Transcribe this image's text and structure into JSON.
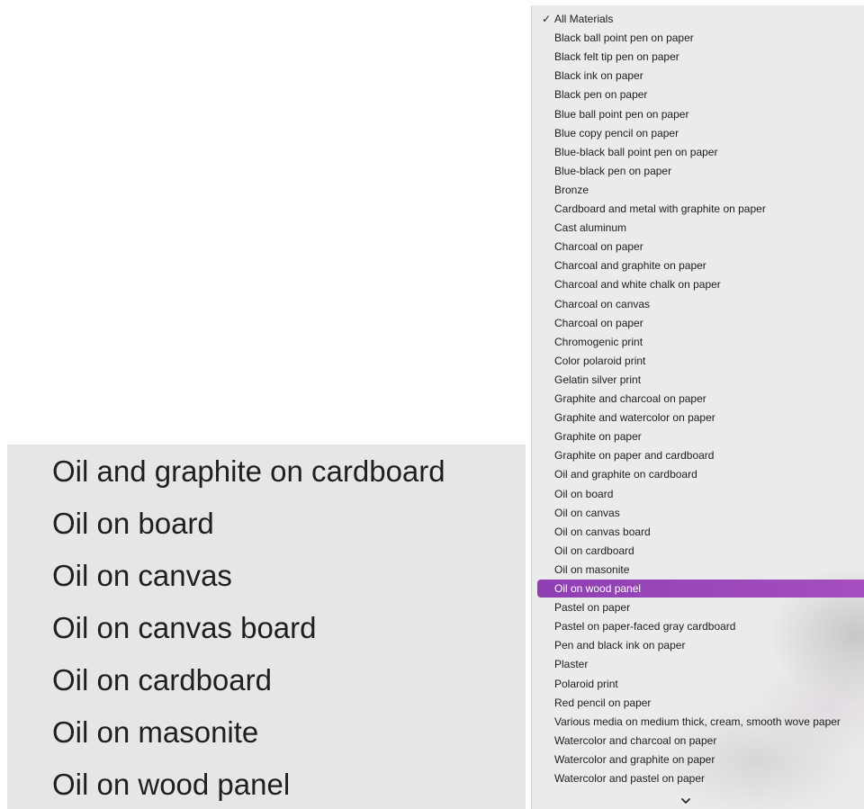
{
  "zoom": {
    "items": [
      "Oil and graphite on cardboard",
      "Oil on board",
      "Oil on canvas",
      "Oil on canvas board",
      "Oil on cardboard",
      "Oil on masonite",
      "Oil on wood panel"
    ]
  },
  "menu": {
    "check_mark": "✓",
    "selected_index": 0,
    "highlighted_index": 30,
    "highlight_color": "#9b47bb",
    "items": [
      "All Materials",
      "Black ball point pen on paper",
      "Black felt tip pen on paper",
      "Black ink on paper",
      "Black pen on paper",
      "Blue ball point pen on paper",
      "Blue copy pencil on paper",
      "Blue-black ball point pen on paper",
      "Blue-black pen on paper",
      "Bronze",
      "Cardboard and metal with graphite on paper",
      "Cast aluminum",
      "Charcoal on paper",
      "Charcoal and graphite on paper",
      "Charcoal and white chalk on paper",
      "Charcoal on canvas",
      "Charcoal on paper",
      "Chromogenic print",
      "Color polaroid print",
      "Gelatin silver print",
      "Graphite and charcoal on paper",
      "Graphite and watercolor on paper",
      "Graphite on paper",
      "Graphite on paper and cardboard",
      "Oil and graphite on cardboard",
      "Oil on board",
      "Oil on canvas",
      "Oil on canvas board",
      "Oil on cardboard",
      "Oil on masonite",
      "Oil on wood panel",
      "Pastel on paper",
      "Pastel on paper-faced gray cardboard",
      "Pen and black ink on paper",
      "Plaster",
      "Polaroid print",
      "Red pencil on paper",
      "Various media on medium thick, cream, smooth wove paper",
      "Watercolor and charcoal on paper",
      "Watercolor and graphite on paper",
      "Watercolor and pastel on paper"
    ],
    "scroll_indicator_icon": "chevron-down-icon"
  }
}
